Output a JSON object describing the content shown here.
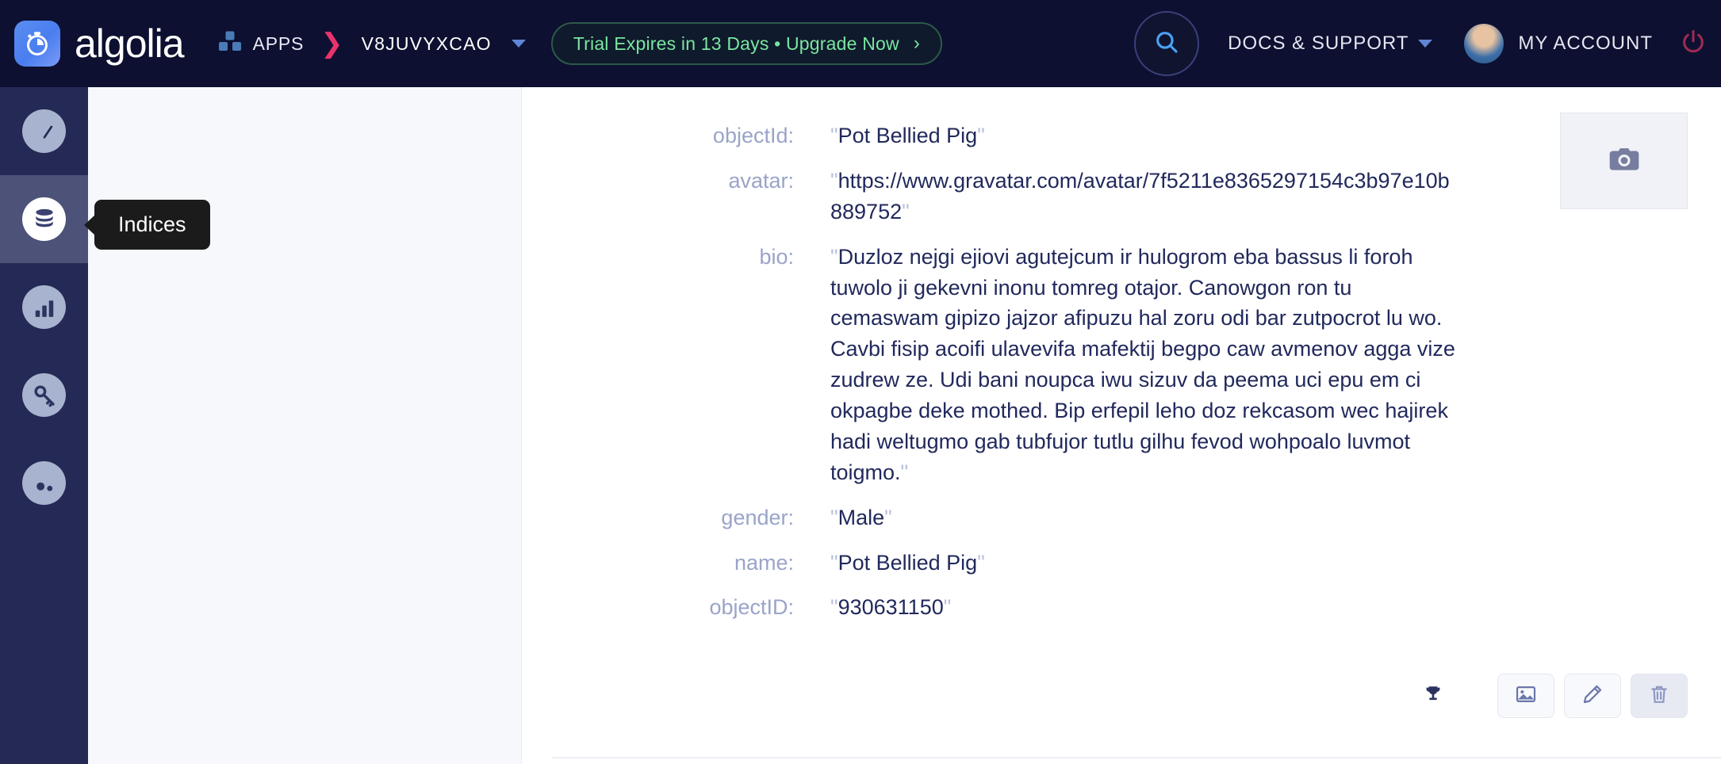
{
  "brand": {
    "name": "algolia",
    "logo_icon": "algolia-stopwatch-icon"
  },
  "topnav": {
    "apps_label": "APPS",
    "apps_icon": "cubes-icon",
    "crumb_separator": "❯",
    "app_id": "V8JUVYXCAO",
    "app_caret_icon": "caret-down-icon",
    "trial": {
      "text": "Trial Expires in 13 Days • Upgrade Now",
      "arrow": "›",
      "accent_color": "#7ae6a0",
      "border_color": "#2c5a48"
    },
    "search_icon": "search-icon",
    "docs_support_label": "DOCS & SUPPORT",
    "docs_caret_icon": "caret-down-icon",
    "avatar_icon": "user-avatar",
    "my_account_label": "MY ACCOUNT",
    "logout_icon": "power-icon",
    "background_color": "#0d1030"
  },
  "sidebar": {
    "background_color": "#242a55",
    "active_color": "#4d5279",
    "items": [
      {
        "name": "dashboard",
        "icon": "speedometer-icon",
        "active": false
      },
      {
        "name": "indices",
        "icon": "database-icon",
        "active": true
      },
      {
        "name": "analytics",
        "icon": "bar-chart-icon",
        "active": false
      },
      {
        "name": "api-keys",
        "icon": "key-icon",
        "active": false
      },
      {
        "name": "monitoring",
        "icon": "monitoring-icon",
        "active": false
      }
    ],
    "tooltip": {
      "label": "Indices",
      "background_color": "#1b1b1b"
    }
  },
  "record": {
    "image_placeholder_icon": "camera-icon",
    "fields": [
      {
        "label": "objectId:",
        "value": "Pot Bellied Pig",
        "quoted": true
      },
      {
        "label": "avatar:",
        "value": "https://www.gravatar.com/avatar/7f5211e8365297154c3b97e10b889752",
        "quoted": true
      },
      {
        "label": "bio:",
        "value": "Duzloz nejgi ejiovi agutejcum ir hulogrom eba bassus li foroh tuwolo ji gekevni inonu tomreg otajor. Canowgon ron tu cemaswam gipizo jajzor afipuzu hal zoru odi bar zutpocrot lu wo. Cavbi fisip acoifi ulavevifa mafektij begpo caw avmenov agga vize zudrew ze. Udi bani noupca iwu sizuv da peema uci epu em ci okpagbe deke mothed. Bip erfepil leho doz rekcasom wec hajirek hadi weltugmo gab tubfujor tutlu gilhu fevod wohpoalo luvmot toigmo.",
        "quoted": true
      },
      {
        "label": "gender:",
        "value": "Male",
        "quoted": true
      },
      {
        "label": "name:",
        "value": "Pot Bellied Pig",
        "quoted": true
      },
      {
        "label": "objectID:",
        "value": "930631150",
        "quoted": true
      }
    ],
    "label_color": "#9aa4c8",
    "value_color": "#21295c"
  },
  "actions": {
    "trophy_icon": "trophy-icon",
    "buttons": [
      {
        "name": "view-image",
        "icon": "image-icon"
      },
      {
        "name": "edit-record",
        "icon": "pencil-icon"
      },
      {
        "name": "delete-record",
        "icon": "trash-icon"
      }
    ]
  }
}
